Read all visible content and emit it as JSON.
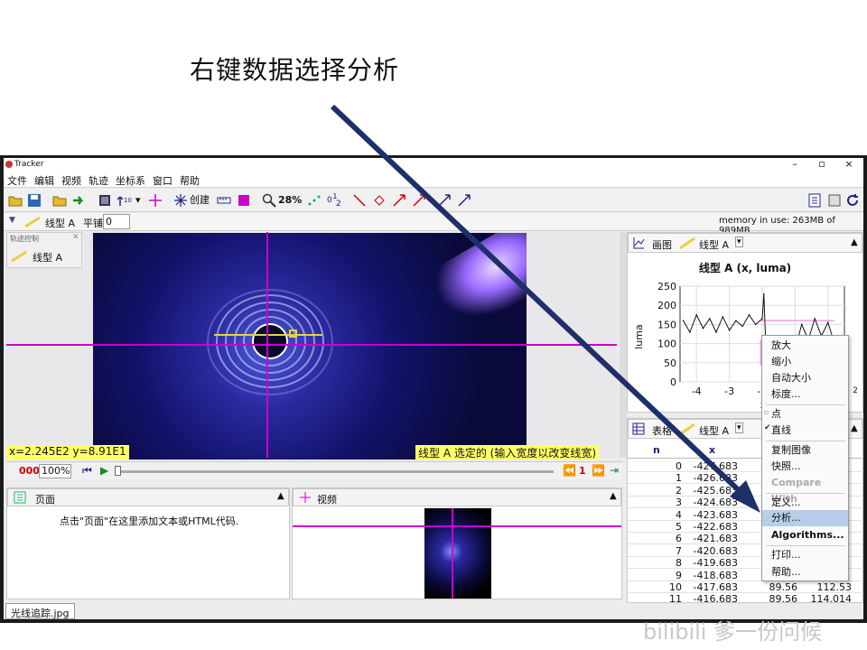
{
  "slide": {
    "title": "右键数据选择分析"
  },
  "window": {
    "app_title": "Tracker",
    "controls": [
      "–",
      "▫",
      "×"
    ]
  },
  "menu": [
    "文件",
    "编辑",
    "视频",
    "轨迹",
    "坐标系",
    "窗口",
    "帮助"
  ],
  "toolbar": {
    "create_label": "创建",
    "zoom": "28%"
  },
  "trackbar": {
    "track_name": "线型 A",
    "smooth_label": "平铺",
    "smooth_value": "0",
    "memory": "memory in use: 263MB of 989MB"
  },
  "track_control": {
    "title": "轨迹控制",
    "item": "线型 A"
  },
  "video": {
    "coord_readout": "x=2.245E2  y=8.91E1",
    "selection_msg": "线型 A 选定的 (输入宽度以改变线宽)"
  },
  "playback": {
    "frame": "000",
    "rate": "100%",
    "step": "1"
  },
  "page_panel": {
    "title": "页面",
    "hint": "点击\"页面\"在这里添加文本或HTML代码."
  },
  "video_panel": {
    "title": "视频"
  },
  "plot_panel": {
    "tab_label": "画图",
    "track_label": "线型 A",
    "chart_title": "线型 A (x, luma)",
    "ylabel": "luma",
    "xlabel": "x",
    "yticks": [
      "250",
      "200",
      "150",
      "100",
      "50",
      "0"
    ],
    "xticks": [
      "-4",
      "-3",
      "-2",
      "-1",
      "0"
    ],
    "x_exponent": "2"
  },
  "table_panel": {
    "tab_label": "表格",
    "track_label": "线型 A",
    "headers": [
      "n",
      "x"
    ],
    "rows": [
      {
        "n": "0",
        "x": "-427.683"
      },
      {
        "n": "1",
        "x": "-426.683"
      },
      {
        "n": "2",
        "x": "-425.683"
      },
      {
        "n": "3",
        "x": "-424.683"
      },
      {
        "n": "4",
        "x": "-423.683"
      },
      {
        "n": "5",
        "x": "-422.683"
      },
      {
        "n": "6",
        "x": "-421.683"
      },
      {
        "n": "7",
        "x": "-420.683"
      },
      {
        "n": "8",
        "x": "-419.683"
      },
      {
        "n": "9",
        "x": "-418.683"
      },
      {
        "n": "10",
        "x": "-417.683",
        "c3": "89.56",
        "c4": "112.53"
      },
      {
        "n": "11",
        "x": "-416.683",
        "c3": "89.56",
        "c4": "114.014"
      }
    ]
  },
  "context_menu": {
    "items": [
      "放大",
      "缩小",
      "自动大小",
      "标度...",
      "点",
      "直线",
      "复制图像",
      "快照...",
      "Compare With",
      "定义...",
      "分析...",
      "Algorithms...",
      "打印...",
      "帮助..."
    ],
    "highlighted": "分析..."
  },
  "status": {
    "file_tab": "光线追踪.jpg"
  },
  "watermark": "bilibili 爹一份问候",
  "chart_data": {
    "type": "line",
    "title": "线型 A (x, luma)",
    "xlabel": "x",
    "ylabel": "luma",
    "xlim": [
      -4.5,
      0.5
    ],
    "ylim": [
      0,
      250
    ],
    "x": [
      -4.4,
      -4.2,
      -4.0,
      -3.8,
      -3.6,
      -3.4,
      -3.2,
      -3.0,
      -2.8,
      -2.6,
      -2.4,
      -2.2,
      -2.0,
      -1.95,
      -1.9,
      -1.8,
      -1.6,
      -1.4,
      -1.2,
      -1.0,
      -0.8,
      -0.6,
      -0.4,
      -0.2,
      0.0,
      0.2,
      0.4
    ],
    "y": [
      160,
      130,
      175,
      140,
      165,
      130,
      170,
      135,
      160,
      145,
      175,
      150,
      165,
      230,
      115,
      95,
      85,
      80,
      90,
      85,
      150,
      110,
      165,
      120,
      155,
      100,
      70
    ]
  }
}
